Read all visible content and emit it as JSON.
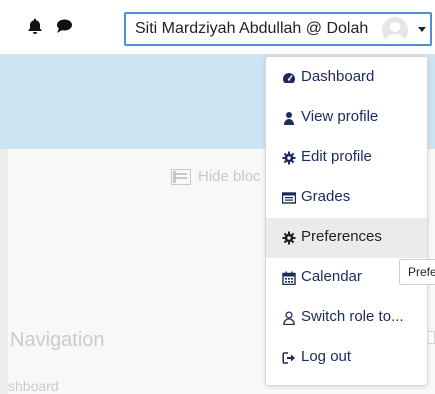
{
  "navbar": {
    "notifications_icon": "bell-icon",
    "messages_icon": "chat-bubble-icon",
    "user_name": "Siti Mardziyah Abdullah @ Dolah",
    "avatar_icon": "default-avatar-icon"
  },
  "page": {
    "hide_blocks_label": "Hide bloc",
    "navigation_heading": "Navigation",
    "dashboard_link_fragment": "shboard"
  },
  "user_menu": {
    "items": [
      {
        "label": "Dashboard",
        "icon": "tachometer-icon"
      },
      {
        "label": "View profile",
        "icon": "user-icon"
      },
      {
        "label": "Edit profile",
        "icon": "cog-icon"
      },
      {
        "label": "Grades",
        "icon": "table-icon"
      },
      {
        "label": "Preferences",
        "icon": "wrench-icon"
      },
      {
        "label": "Calendar",
        "icon": "calendar-icon"
      },
      {
        "label": "Switch role to...",
        "icon": "user-outline-icon"
      },
      {
        "label": "Log out",
        "icon": "sign-out-icon"
      }
    ],
    "active_item": "Preferences"
  },
  "tooltip": {
    "text": "Prefe"
  },
  "colors": {
    "accent_border": "#4a90d9",
    "menu_text": "#1c2a5c",
    "banner": "#cfe4f2",
    "active_bg": "#ebebeb"
  }
}
